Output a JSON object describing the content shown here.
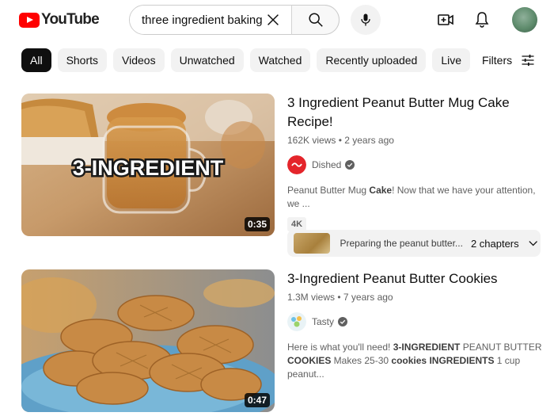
{
  "header": {
    "logo_text": "YouTube",
    "search_value": "three ingredient baking",
    "search_placeholder": "Search"
  },
  "chips": [
    "All",
    "Shorts",
    "Videos",
    "Unwatched",
    "Watched",
    "Recently uploaded",
    "Live"
  ],
  "filters_label": "Filters",
  "results": [
    {
      "title": "3 Ingredient Peanut Butter Mug Cake Recipe!",
      "meta": "162K views • 2 years ago",
      "channel": "Dished",
      "thumb_text": "3-INGREDIENT",
      "duration": "0:35",
      "desc_parts": [
        "Peanut Butter Mug ",
        "Cake",
        "! Now that we have your attention, we ..."
      ],
      "badge": "4K",
      "chapter_text": "Preparing the peanut butter...",
      "chapter_count": "2 chapters"
    },
    {
      "title": "3-Ingredient Peanut Butter Cookies",
      "meta": "1.3M views • 7 years ago",
      "channel": "Tasty",
      "duration": "0:47",
      "desc_line1": [
        "Here is what you'll need! ",
        "3-INGREDIENT",
        " PEANUT BUTTER"
      ],
      "desc_line2": [
        "COOKIES",
        " Makes 25-30 ",
        "cookies",
        " ",
        "INGREDIENTS",
        " 1 cup peanut..."
      ]
    }
  ],
  "colors": {
    "brand_red": "#ff0000",
    "chip_active_bg": "#0f0f0f",
    "chip_bg": "#f2f2f2",
    "meta_text": "#606060"
  }
}
